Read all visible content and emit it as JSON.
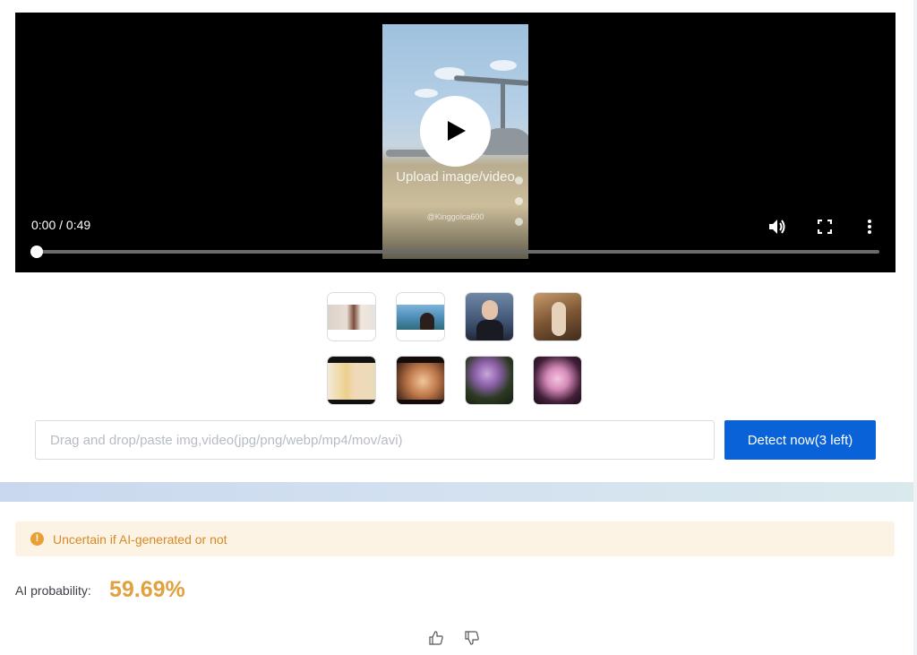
{
  "player": {
    "time": "0:00 / 0:49",
    "progress_fraction": 0,
    "video_overlay_text": "Upload image/video",
    "video_watermark": "@Kinggolca600"
  },
  "thumbnails": [
    {
      "name": "sample-portrait-woman"
    },
    {
      "name": "sample-woman-lake"
    },
    {
      "name": "sample-man-portrait"
    },
    {
      "name": "sample-woman-seated"
    },
    {
      "name": "sample-blonde-woman"
    },
    {
      "name": "sample-woman-glow"
    },
    {
      "name": "sample-purple-flowers"
    },
    {
      "name": "sample-pink-flowers"
    }
  ],
  "upload": {
    "placeholder": "Drag and drop/paste img,video(jpg/png/webp/mp4/mov/avi)",
    "value": "",
    "button_label": "Detect now(3 left)"
  },
  "result": {
    "alert_text": "Uncertain if AI-generated or not",
    "alert_icon": "exclamation-icon",
    "probability_label": "AI probability:",
    "probability_value": "59.69%"
  },
  "colors": {
    "accent": "#0a62d8",
    "warning": "#e1a13e",
    "warning_bg": "#fdf3e5"
  }
}
